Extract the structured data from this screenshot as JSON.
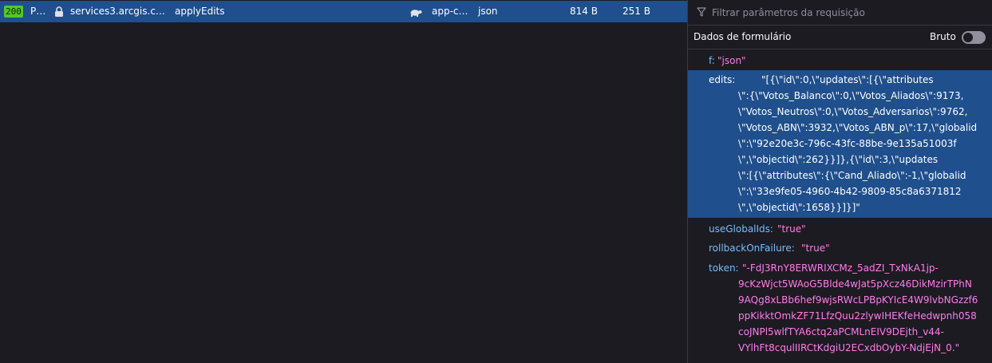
{
  "request": {
    "status": "200",
    "method": "P…",
    "domain": "services3.arcgis.c…",
    "file": "applyEdits",
    "initiator": "app-c…",
    "type": "json",
    "transferred": "814 B",
    "size": "251 B",
    "lock_icon": "lock-icon",
    "throttle_icon": "turtle-icon"
  },
  "panel": {
    "filter_placeholder": "Filtrar parâmetros da requisição",
    "filter_icon": "funnel-icon",
    "section_title": "Dados de formulário",
    "raw_label": "Bruto",
    "raw_toggle_on": false
  },
  "params": [
    {
      "key": "f:",
      "lines": [
        "\"json\""
      ]
    },
    {
      "key": "edits:",
      "lines": [
        "\"[{\\\"id\\\":0,\\\"updates\\\":[{\\\"attributes",
        "\\\":{\\\"Votos_Balanco\\\":0,\\\"Votos_Aliados\\\":9173,",
        "\\\"Votos_Neutros\\\":0,\\\"Votos_Adversarios\\\":9762,",
        "\\\"Votos_ABN\\\":3932,\\\"Votos_ABN_p\\\":17,\\\"globalid",
        "\\\":\\\"92e20e3c-796c-43fc-88be-9e135a51003f",
        "\\\",\\\"objectid\\\":262}}]},{\\\"id\\\":3,\\\"updates",
        "\\\":[{\\\"attributes\\\":{\\\"Cand_Aliado\\\":-1,\\\"globalid",
        "\\\":\\\"33e9fe05-4960-4b42-9809-85c8a6371812",
        "\\\",\\\"objectid\\\":1658}}]}]\""
      ]
    },
    {
      "key": "useGlobalIds:",
      "lines": [
        "\"true\""
      ]
    },
    {
      "key": "rollbackOnFailure:",
      "lines": [
        "\"true\""
      ]
    },
    {
      "key": "token:",
      "lines": [
        "\"-FdJ3RnY8ERWRIXCMz_5adZI_TxNkA1jp-",
        "9cKzWjct5WAoG5Blde4wJat5pXcz46DikMzirTPhN",
        "9AQg8xLBb6hef9wjsRWcLPBpKYIcE4W9lvbNGzzf6",
        "ppKikktOmkZF71LfzQuu2zlywIHEKfeHedwpnh058",
        "coJNPl5wlfTYA6ctq2aPCMLnEIV9DEjth_v44-",
        "VYlhFt8cqulIIRCtKdgiU2ECxdbOybY-NdjEjN_0.\""
      ]
    }
  ]
}
